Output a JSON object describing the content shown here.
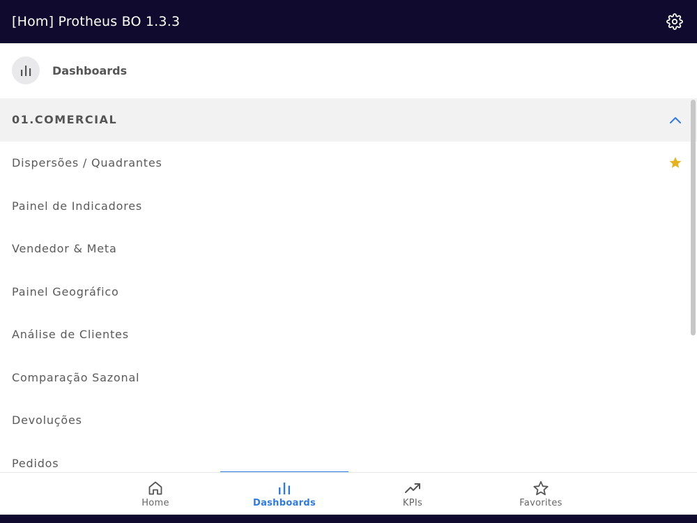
{
  "app": {
    "title": "[Hom] Protheus BO 1.3.3",
    "colors": {
      "topbar": "#100a2e",
      "accent": "#2f7ae5",
      "star": "#e5b21e",
      "group_bg": "#f2f2f2"
    }
  },
  "header": {
    "icon": "bar-chart-icon",
    "label": "Dashboards"
  },
  "group": {
    "label": "01.COMERCIAL",
    "expanded": true
  },
  "list": {
    "items": [
      {
        "label": "Dispersões / Quadrantes",
        "favorite": true
      },
      {
        "label": "Painel de Indicadores",
        "favorite": false
      },
      {
        "label": "Vendedor & Meta",
        "favorite": false
      },
      {
        "label": "Painel Geográfico",
        "favorite": false
      },
      {
        "label": "Análise de Clientes",
        "favorite": false
      },
      {
        "label": "Comparação Sazonal",
        "favorite": false
      },
      {
        "label": "Devoluções",
        "favorite": false
      },
      {
        "label": "Pedidos",
        "favorite": false
      }
    ]
  },
  "bottom_nav": {
    "items": [
      {
        "label": "Home",
        "icon": "home-icon",
        "active": false
      },
      {
        "label": "Dashboards",
        "icon": "bar-chart-icon",
        "active": true
      },
      {
        "label": "KPIs",
        "icon": "trending-up-icon",
        "active": false
      },
      {
        "label": "Favorites",
        "icon": "star-outline-icon",
        "active": false
      }
    ]
  }
}
